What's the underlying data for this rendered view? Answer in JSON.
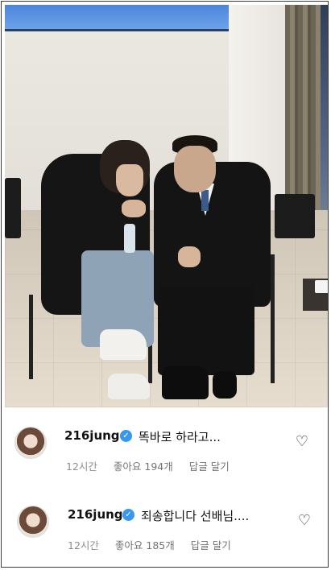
{
  "comments": [
    {
      "username": "216jung",
      "text": "똑바로 하라고...",
      "time": "12시간",
      "likes": "좋아요 194개",
      "reply": "답글 달기",
      "verified_icon": "verified-badge-icon",
      "like_icon": "heart-outline-icon"
    },
    {
      "username": "216jung",
      "text": "죄송합니다 선배님....",
      "time": "12시간",
      "likes": "좋아요 185개",
      "reply": "답글 달기",
      "verified_icon": "verified-badge-icon",
      "like_icon": "heart-outline-icon"
    }
  ],
  "colors": {
    "verified": "#3897f0",
    "meta_text": "#8e8e8e",
    "username": "#111111"
  }
}
